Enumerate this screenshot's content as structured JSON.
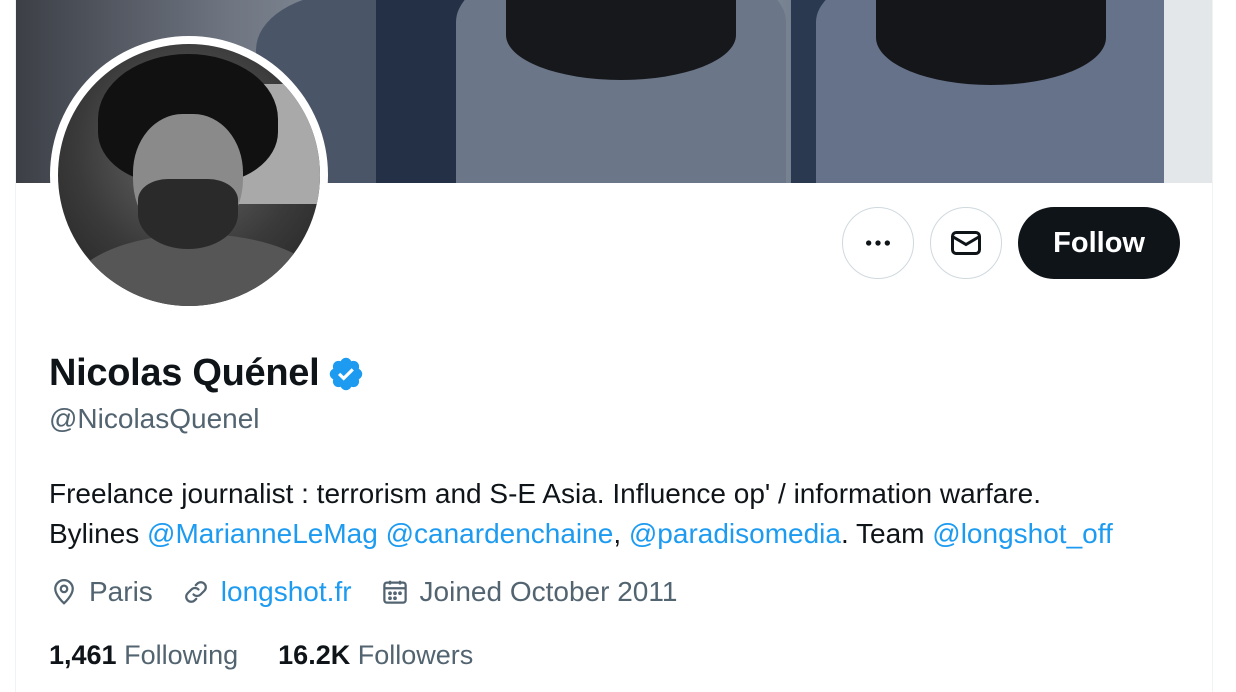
{
  "profile": {
    "name": "Nicolas Quénel",
    "handle": "@NicolasQuenel",
    "verified": true,
    "verified_icon": "verified-badge-icon"
  },
  "actions": {
    "more_icon": "more-horizontal-icon",
    "message_icon": "envelope-icon",
    "follow_label": "Follow"
  },
  "bio": {
    "line1": "Freelance journalist : terrorism and S-E Asia. Influence op' / information warfare.",
    "bylines_prefix": "Bylines ",
    "mention1": "@MarianneLeMag",
    "mention2": "@canardenchaine",
    "separator": ", ",
    "mention3": "@paradisomedia",
    "team_text": ". Team ",
    "mention4": "@longshot_off"
  },
  "meta": {
    "location": "Paris",
    "location_icon": "location-pin-icon",
    "website": "longshot.fr",
    "website_icon": "link-icon",
    "joined": "Joined October 2011",
    "joined_icon": "calendar-icon"
  },
  "stats": {
    "following_count": "1,461",
    "following_label": "Following",
    "followers_count": "16.2K",
    "followers_label": "Followers"
  },
  "colors": {
    "accent": "#1d9bf0",
    "text_primary": "#0f1419",
    "text_secondary": "#536471",
    "follow_bg": "#0f1419"
  }
}
